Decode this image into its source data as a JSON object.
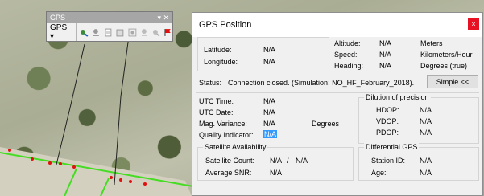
{
  "toolbar": {
    "title": "GPS",
    "title_buttons": "▾ ✕",
    "dropdown_label": "GPS ▾",
    "icons": [
      "gps-connect-icon",
      "gps-move-icon",
      "gps-track-icon",
      "gps-log-icon",
      "gps-log-settings-icon",
      "gps-zoom-icon",
      "gps-pan-icon",
      "gps-flag-icon"
    ]
  },
  "dialog": {
    "title": "GPS Position",
    "close_label": "×",
    "latitude": {
      "label": "Latitude:",
      "value": "N/A"
    },
    "longitude": {
      "label": "Longitude:",
      "value": "N/A"
    },
    "altitude": {
      "label": "Altitude:",
      "value": "N/A",
      "unit": "Meters"
    },
    "speed": {
      "label": "Speed:",
      "value": "N/A",
      "unit": "Kilometers/Hour"
    },
    "heading": {
      "label": "Heading:",
      "value": "N/A",
      "unit": "Degrees (true)"
    },
    "status": {
      "label": "Status:",
      "text": "Connection closed. (Simulation: NO_HF_February_2018)."
    },
    "simple_button": "Simple <<",
    "utc_time": {
      "label": "UTC Time:",
      "value": "N/A"
    },
    "utc_date": {
      "label": "UTC Date:",
      "value": "N/A"
    },
    "mag_variance": {
      "label": "Mag. Variance:",
      "value": "N/A",
      "unit": "Degrees"
    },
    "quality": {
      "label": "Quality Indicator:",
      "value": "N/A"
    },
    "dop": {
      "title": "Dilution of precision",
      "hdop": {
        "label": "HDOP:",
        "value": "N/A"
      },
      "vdop": {
        "label": "VDOP:",
        "value": "N/A"
      },
      "pdop": {
        "label": "PDOP:",
        "value": "N/A"
      }
    },
    "satellite": {
      "title": "Satellite Availability",
      "count": {
        "label": "Satellite Count:",
        "value": "N/A",
        "separator": "/",
        "value2": "N/A"
      },
      "snr": {
        "label": "Average SNR:",
        "value": "N/A"
      }
    },
    "dgps": {
      "title": "Differential GPS",
      "station": {
        "label": "Station ID:",
        "value": "N/A"
      },
      "age": {
        "label": "Age:",
        "value": "N/A"
      }
    }
  },
  "colors": {
    "close": "#e81123",
    "selection": "#3399ff",
    "road_line": "#44dd22",
    "road_points": "#e01010"
  }
}
